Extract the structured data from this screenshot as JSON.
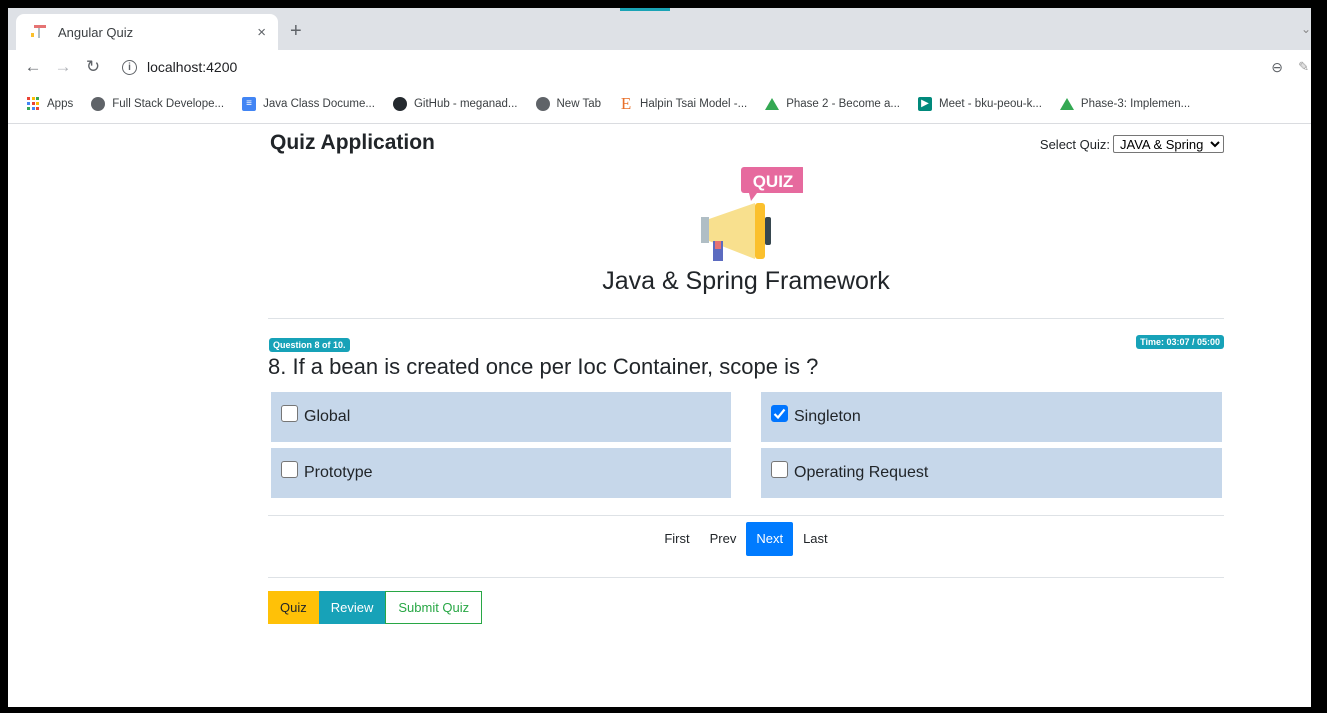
{
  "browser": {
    "tab_title": "Angular Quiz",
    "tab_close": "×",
    "new_tab": "+",
    "url": "localhost:4200",
    "bookmarks": [
      {
        "label": "Apps",
        "icon": "apps-icon"
      },
      {
        "label": "Full Stack Develope...",
        "icon": "globe-icon"
      },
      {
        "label": "Java Class Docume...",
        "icon": "doc-icon"
      },
      {
        "label": "GitHub - meganad...",
        "icon": "github-icon"
      },
      {
        "label": "New Tab",
        "icon": "globe-icon"
      },
      {
        "label": "Halpin Tsai Model -...",
        "icon": "e-icon"
      },
      {
        "label": "Phase 2 - Become a...",
        "icon": "drive-icon"
      },
      {
        "label": "Meet - bku-peou-k...",
        "icon": "meet-icon"
      },
      {
        "label": "Phase-3: Implemen...",
        "icon": "drive-icon"
      }
    ]
  },
  "app": {
    "title": "Quiz Application",
    "select_label": "Select Quiz:",
    "selected_quiz": "JAVA & Spring",
    "logo_text": "QUIZ",
    "quiz_name": "Java & Spring Framework"
  },
  "question": {
    "counter": "Question 8 of 10.",
    "timer": "Time: 03:07 / 05:00",
    "text": "8. If a bean is created once per Ioc Container, scope is ?",
    "options": [
      {
        "label": "Global",
        "checked": false
      },
      {
        "label": "Singleton",
        "checked": true
      },
      {
        "label": "Prototype",
        "checked": false
      },
      {
        "label": "Operating Request",
        "checked": false
      }
    ]
  },
  "pager": {
    "first": "First",
    "prev": "Prev",
    "next": "Next",
    "last": "Last"
  },
  "actions": {
    "quiz": "Quiz",
    "review": "Review",
    "submit": "Submit Quiz"
  },
  "colors": {
    "option_bg": "#c6d7ea",
    "badge": "#17a2b8",
    "primary": "#007bff",
    "warning": "#ffc107",
    "success": "#28a745"
  }
}
